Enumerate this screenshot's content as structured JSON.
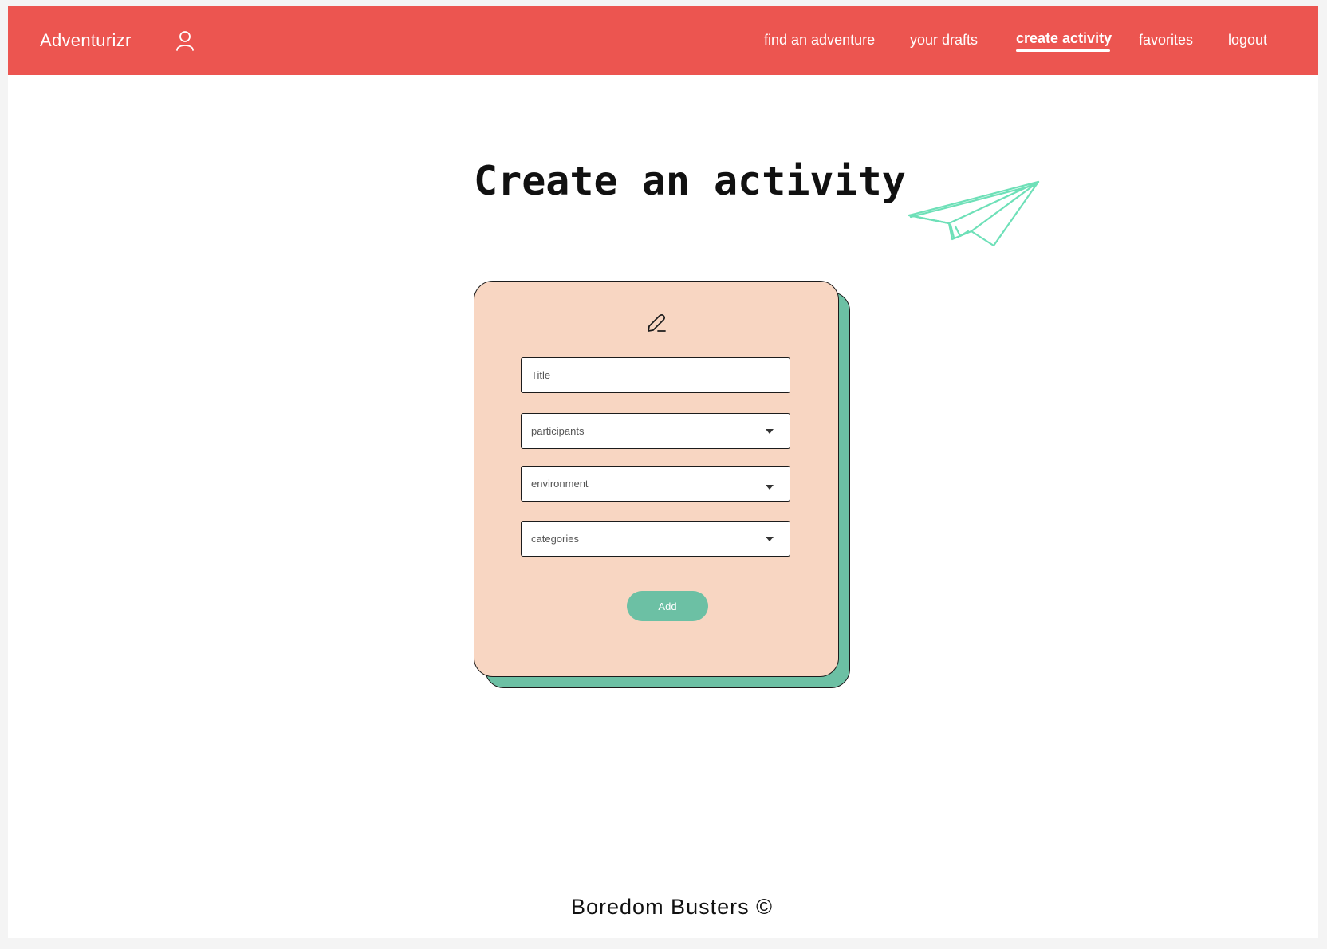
{
  "header": {
    "brand": "Adventurizr",
    "user_icon": "user-icon",
    "nav": [
      {
        "label": "find an adventure",
        "active": false
      },
      {
        "label": "your drafts",
        "active": false
      },
      {
        "label": "create activity",
        "active": true
      },
      {
        "label": "favorites",
        "active": false
      },
      {
        "label": "logout",
        "active": false
      }
    ],
    "background_color": "#ec5550"
  },
  "main": {
    "title": "Create an activity",
    "decoration_icon": "paper-plane-icon",
    "form": {
      "icon": "pen-icon",
      "title_placeholder": "Title",
      "participants_placeholder": "participants",
      "environment_placeholder": "environment",
      "categories_placeholder": "categories",
      "submit_label": "Add",
      "card_color": "#f8d6c2",
      "accent_color": "#6cc0a4"
    }
  },
  "footer": {
    "text": "Boredom Busters ©"
  }
}
